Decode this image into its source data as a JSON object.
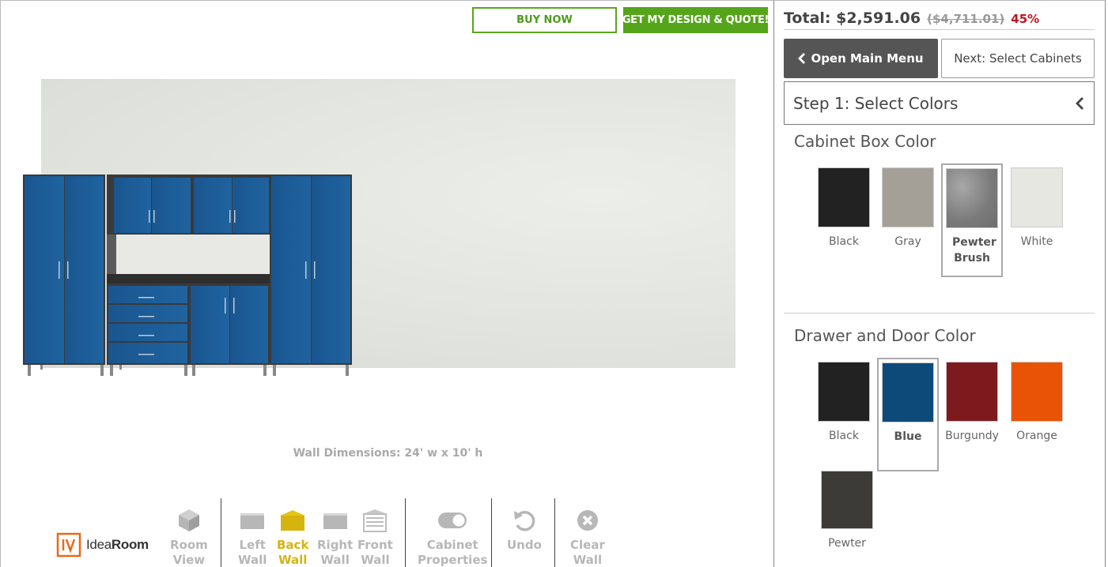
{
  "header_buttons": {
    "buy_now": "BUY NOW",
    "quote": "GET MY DESIGN & QUOTE!"
  },
  "canvas": {
    "wall_dimensions": "Wall Dimensions: 24' w x 10' h"
  },
  "logo": {
    "text_plain": "Idea",
    "text_bold": "Room",
    "icon": "idearoom-logo"
  },
  "toolbar": [
    {
      "line1": "Room",
      "line2": "View",
      "icon": "cube-icon"
    },
    {
      "line1": "Left",
      "line2": "Wall",
      "icon": "wall-icon"
    },
    {
      "line1": "Back",
      "line2": "Wall",
      "icon": "wall-icon",
      "active": true
    },
    {
      "line1": "Right",
      "line2": "Wall",
      "icon": "wall-icon"
    },
    {
      "line1": "Front",
      "line2": "Wall",
      "icon": "garage-door-icon"
    },
    {
      "line1": "Cabinet",
      "line2": "Properties",
      "icon": "toggle-icon"
    },
    {
      "line1": "Undo",
      "line2": "",
      "icon": "undo-icon"
    },
    {
      "line1": "Clear",
      "line2": "Wall",
      "icon": "clear-icon"
    }
  ],
  "panel": {
    "total": "Total: $2,591.06",
    "old_price": "($4,711.01)",
    "discount": "45%",
    "open_menu": "Open Main Menu",
    "next": "Next: Select Cabinets",
    "step_title": "Step 1: Select Colors",
    "box_color_title": "Cabinet Box Color",
    "box_colors": [
      {
        "label": "Black",
        "color": "#222222"
      },
      {
        "label": "Gray",
        "color": "#a5a097"
      },
      {
        "label": "Pewter Brush",
        "color": "#8a8a8a",
        "selected": true
      },
      {
        "label": "White",
        "color": "#e6e7e1"
      }
    ],
    "door_color_title": "Drawer and Door Color",
    "door_colors": [
      {
        "label": "Black",
        "color": "#222222"
      },
      {
        "label": "Blue",
        "color": "#0d4a7a",
        "selected": true
      },
      {
        "label": "Burgundy",
        "color": "#7e1a1d"
      },
      {
        "label": "Orange",
        "color": "#e85305"
      },
      {
        "label": "Pewter",
        "color": "#3d3b38"
      }
    ]
  },
  "colors": {
    "accent_green": "#55a51a",
    "active_yellow": "#d6b40f",
    "price_red": "#c0141b",
    "cabinet_blue": "#1b5c93"
  }
}
